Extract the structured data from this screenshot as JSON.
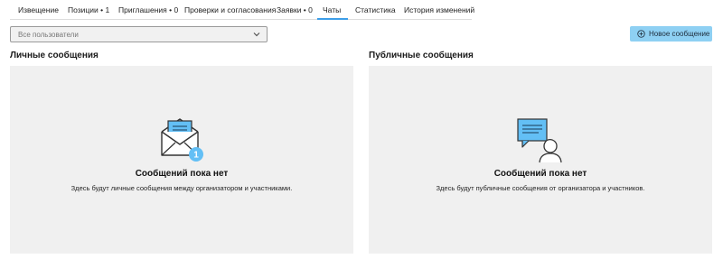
{
  "tabs": [
    {
      "label": "Извещение"
    },
    {
      "label": "Позиции • 1"
    },
    {
      "label": "Приглашения • 0"
    },
    {
      "label": "Проверки и согласования"
    },
    {
      "label": "Заявки • 0"
    },
    {
      "label": "Чаты"
    },
    {
      "label": "Статистика"
    },
    {
      "label": "История изменений"
    }
  ],
  "active_tab": "Чаты",
  "filter": {
    "selected": "Все пользователи"
  },
  "new_message_button": {
    "label": "Новое сообщение"
  },
  "private_section": {
    "title": "Личные сообщения",
    "empty_title": "Сообщений пока нет",
    "empty_text": "Здесь будут личные сообщения между организатором и участниками.",
    "badge": "1"
  },
  "public_section": {
    "title": "Публичные сообщения",
    "empty_title": "Сообщений пока нет",
    "empty_text": "Здесь будут публичные сообщения от организатора и участников."
  },
  "colors": {
    "accent": "#3d9ee8",
    "button_bg": "#8ed0f3",
    "icon_blue": "#63bff5",
    "panel_bg": "#f0f0f0"
  }
}
